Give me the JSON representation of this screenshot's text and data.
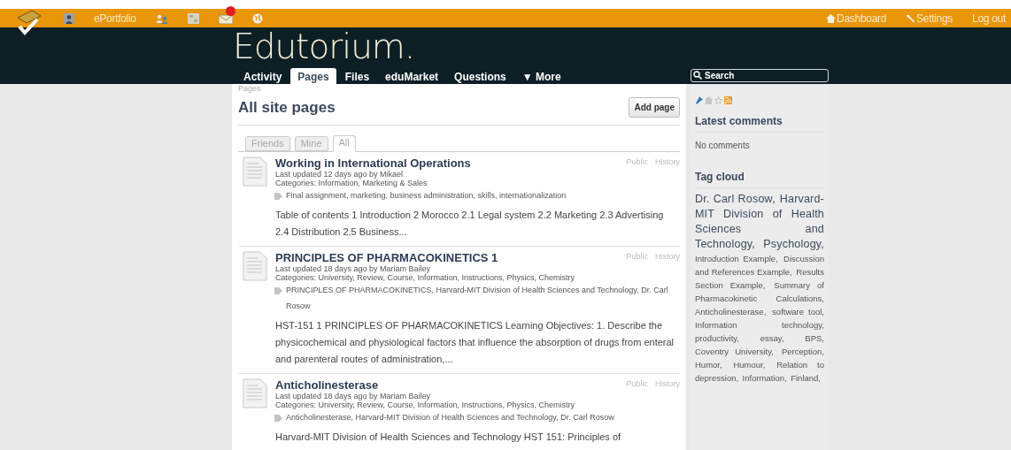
{
  "top_bar": {
    "left": [
      {
        "kind": "logo"
      },
      {
        "kind": "profile"
      },
      {
        "kind": "text",
        "label": "ePortfolio"
      },
      {
        "kind": "friends"
      },
      {
        "kind": "grid"
      },
      {
        "kind": "mail",
        "badge": true
      },
      {
        "kind": "globe"
      }
    ],
    "right": [
      {
        "kind": "home",
        "label": "Dashboard"
      },
      {
        "kind": "wrench",
        "label": "Settings"
      },
      {
        "kind": "none",
        "label": "Log out"
      }
    ]
  },
  "header": {
    "logo": "Edutorium.",
    "nav": [
      {
        "label": "Activity",
        "selected": false
      },
      {
        "label": "Pages",
        "selected": true
      },
      {
        "label": "Files",
        "selected": false
      },
      {
        "label": "eduMarket",
        "selected": false
      },
      {
        "label": "Questions",
        "selected": false
      },
      {
        "label": "▼ More",
        "selected": false
      }
    ],
    "search": {
      "placeholder": "Search"
    }
  },
  "main": {
    "breadcrumb": "Pages",
    "title": "All site pages",
    "add_button": "Add page",
    "tabs": [
      {
        "label": "Friends",
        "selected": false
      },
      {
        "label": "Mine",
        "selected": false
      },
      {
        "label": "All",
        "selected": true
      }
    ],
    "pages": [
      {
        "title": "Working in International Operations",
        "access": "Public",
        "history": "History",
        "updated": "Last updated 12 days ago by Mikael",
        "categories": "Categories: Information, Marketing & Sales",
        "tags": "Final assignment, marketing, business administration, skills, internationalization",
        "summary": "Table of contents 1 Introduction 2 Morocco 2.1 Legal system 2.2 Marketing 2.3 Advertising 2.4 Distribution 2.5 Business..."
      },
      {
        "title": "PRINCIPLES OF PHARMACOKINETICS 1",
        "access": "Public",
        "history": "History",
        "updated": "Last updated 18 days ago by Mariam Bailey",
        "categories": "Categories: University, Review, Course, Information, Instructions, Physics, Chemistry",
        "tags": "PRINCIPLES OF PHARMACOKINETICS, Harvard-MIT Division of Health Sciences and Technology, Dr. Carl Rosow",
        "summary": "HST-151 1 PRINCIPLES OF PHARMACOKINETICS Learning Objectives: 1. Describe the physicochemical and physiological factors that influence the absorption of drugs from enteral and parenteral routes of administration,..."
      },
      {
        "title": "Anticholinesterase",
        "access": "Public",
        "history": "History",
        "updated": "Last updated 18 days ago by Mariam Bailey",
        "categories": "Categories: University, Review, Course, Information, Instructions, Physics, Chemistry",
        "tags": "Anticholinesterase, Harvard-MIT Division of Health Sciences and Technology, Dr. Carl Rosow",
        "summary": "Harvard-MIT Division of Health Sciences and Technology HST 151: Principles of"
      }
    ]
  },
  "sidebar": {
    "latest_comments": {
      "title": "Latest comments",
      "text": "No comments"
    },
    "tag_cloud": {
      "title": "Tag cloud",
      "tags": [
        {
          "label": "Dr. Carl Rosow,",
          "kind": "large"
        },
        {
          "label": "Harvard-MIT Division of Health Sciences and Technology,",
          "kind": "large"
        },
        {
          "label": "Psychology,",
          "kind": "large"
        },
        {
          "label": "Introduction Example,",
          "kind": "small"
        },
        {
          "label": "Discussion and References Example,",
          "kind": "small"
        },
        {
          "label": "Results Section Example,",
          "kind": "small"
        },
        {
          "label": "Summary of Pharmacokinetic Calculations,",
          "kind": "small"
        },
        {
          "label": "Anticholinesterase,",
          "kind": "small"
        },
        {
          "label": "software tool,",
          "kind": "small"
        },
        {
          "label": "Information technology,",
          "kind": "small"
        },
        {
          "label": "productivity,",
          "kind": "small"
        },
        {
          "label": "essay,",
          "kind": "small"
        },
        {
          "label": "BPS,",
          "kind": "small"
        },
        {
          "label": "Coventry University,",
          "kind": "small"
        },
        {
          "label": "Perception,",
          "kind": "small"
        },
        {
          "label": "Humor,",
          "kind": "small"
        },
        {
          "label": "Humour,",
          "kind": "small"
        },
        {
          "label": "Relation to depression,",
          "kind": "small"
        },
        {
          "label": "Information,",
          "kind": "small"
        },
        {
          "label": "Finland,",
          "kind": "small"
        }
      ]
    }
  }
}
